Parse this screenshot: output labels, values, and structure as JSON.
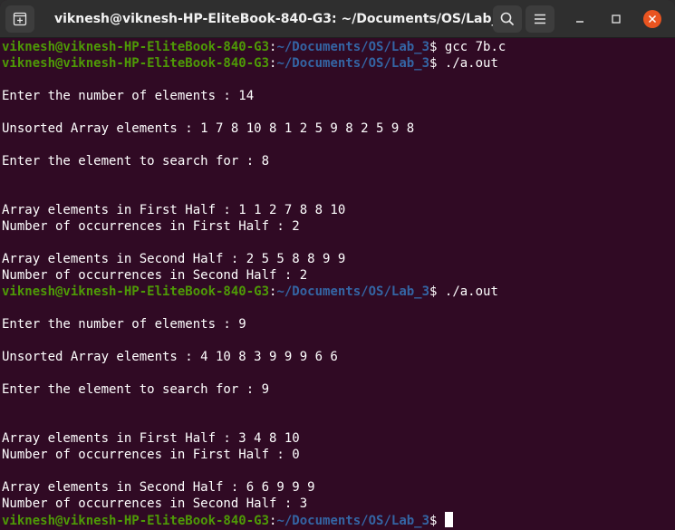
{
  "window": {
    "title": "viknesh@viknesh-HP-EliteBook-840-G3: ~/Documents/OS/Lab_3"
  },
  "colors": {
    "terminal_background": "#300a24",
    "prompt_user": "#4e9a06",
    "prompt_path": "#3465a4",
    "text": "#ffffff",
    "titlebar": "#2f2f2f",
    "close_button": "#e95420"
  },
  "icons": {
    "new_tab": "new-tab-icon",
    "search": "search-icon",
    "menu": "hamburger-menu-icon",
    "minimize": "minimize-icon",
    "maximize": "maximize-icon",
    "close": "close-icon"
  },
  "terminal": {
    "lines": [
      {
        "type": "prompt",
        "user": "viknesh@viknesh-HP-EliteBook-840-G3",
        "colon": ":",
        "path": "~/Documents/OS/Lab_3",
        "sym": "$ ",
        "cmd": "gcc 7b.c"
      },
      {
        "type": "prompt",
        "user": "viknesh@viknesh-HP-EliteBook-840-G3",
        "colon": ":",
        "path": "~/Documents/OS/Lab_3",
        "sym": "$ ",
        "cmd": "./a.out"
      },
      {
        "type": "out",
        "text": ""
      },
      {
        "type": "out",
        "text": "Enter the number of elements : 14"
      },
      {
        "type": "out",
        "text": ""
      },
      {
        "type": "out",
        "text": "Unsorted Array elements : 1 7 8 10 8 1 2 5 9 8 2 5 9 8"
      },
      {
        "type": "out",
        "text": ""
      },
      {
        "type": "out",
        "text": "Enter the element to search for : 8"
      },
      {
        "type": "out",
        "text": ""
      },
      {
        "type": "out",
        "text": ""
      },
      {
        "type": "out",
        "text": "Array elements in First Half : 1 1 2 7 8 8 10"
      },
      {
        "type": "out",
        "text": "Number of occurrences in First Half : 2"
      },
      {
        "type": "out",
        "text": ""
      },
      {
        "type": "out",
        "text": "Array elements in Second Half : 2 5 5 8 8 9 9"
      },
      {
        "type": "out",
        "text": "Number of occurrences in Second Half : 2"
      },
      {
        "type": "prompt",
        "user": "viknesh@viknesh-HP-EliteBook-840-G3",
        "colon": ":",
        "path": "~/Documents/OS/Lab_3",
        "sym": "$ ",
        "cmd": "./a.out"
      },
      {
        "type": "out",
        "text": ""
      },
      {
        "type": "out",
        "text": "Enter the number of elements : 9"
      },
      {
        "type": "out",
        "text": ""
      },
      {
        "type": "out",
        "text": "Unsorted Array elements : 4 10 8 3 9 9 9 6 6"
      },
      {
        "type": "out",
        "text": ""
      },
      {
        "type": "out",
        "text": "Enter the element to search for : 9"
      },
      {
        "type": "out",
        "text": ""
      },
      {
        "type": "out",
        "text": ""
      },
      {
        "type": "out",
        "text": "Array elements in First Half : 3 4 8 10"
      },
      {
        "type": "out",
        "text": "Number of occurrences in First Half : 0"
      },
      {
        "type": "out",
        "text": ""
      },
      {
        "type": "out",
        "text": "Array elements in Second Half : 6 6 9 9 9"
      },
      {
        "type": "out",
        "text": "Number of occurrences in Second Half : 3"
      },
      {
        "type": "prompt",
        "user": "viknesh@viknesh-HP-EliteBook-840-G3",
        "colon": ":",
        "path": "~/Documents/OS/Lab_3",
        "sym": "$ ",
        "cmd": "",
        "cursor": true
      }
    ]
  }
}
